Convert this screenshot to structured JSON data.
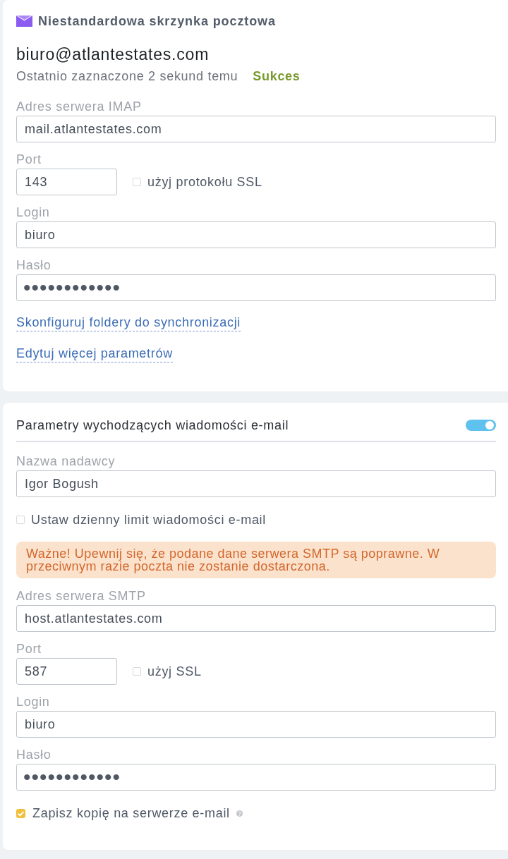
{
  "mailbox": {
    "title": "Niestandardowa skrzynka pocztowa",
    "email": "biuro@atlantestates.com",
    "status": {
      "text": "Ostatnio zaznaczone 2 sekund temu",
      "result": "Sukces",
      "ok": true
    },
    "items": [
      {
        "kind": "text",
        "label": "Adres serwera IMAP",
        "value": "mail.atlantestates.com"
      },
      {
        "kind": "port",
        "label": "Port",
        "value": "143",
        "ssl": {
          "label": "użyj protokołu SSL",
          "checked": false
        }
      },
      {
        "kind": "text",
        "label": "Login",
        "value": "biuro"
      },
      {
        "kind": "password",
        "label": "Hasło",
        "value": "••••••••••••"
      }
    ],
    "links": [
      "Skonfiguruj foldery do synchronizacji",
      "Edytuj więcej parametrów"
    ]
  },
  "outgoing": {
    "title": "Parametry wychodzących wiadomości e-mail",
    "on": true,
    "items": [
      {
        "kind": "text",
        "label": "Nazwa nadawcy",
        "value": "Igor Bogush"
      },
      {
        "kind": "checkbox",
        "label": "Ustaw dzienny limit wiadomości e-mail",
        "checked": false
      },
      {
        "kind": "alert",
        "text": "Ważne! Upewnij się, że podane dane serwera SMTP są poprawne. W przeciwnym razie poczta nie zostanie dostarczona."
      },
      {
        "kind": "text",
        "label": "Adres serwera SMTP",
        "value": "host.atlantestates.com"
      },
      {
        "kind": "port",
        "label": "Port",
        "value": "587",
        "ssl": {
          "label": "użyj SSL",
          "checked": false
        }
      },
      {
        "kind": "text",
        "label": "Login",
        "value": "biuro"
      },
      {
        "kind": "password",
        "label": "Hasło",
        "value": "••••••••••••"
      },
      {
        "kind": "checkbox",
        "label": "Zapisz kopię na serwerze e-mail",
        "checked": true,
        "help": true
      }
    ]
  }
}
